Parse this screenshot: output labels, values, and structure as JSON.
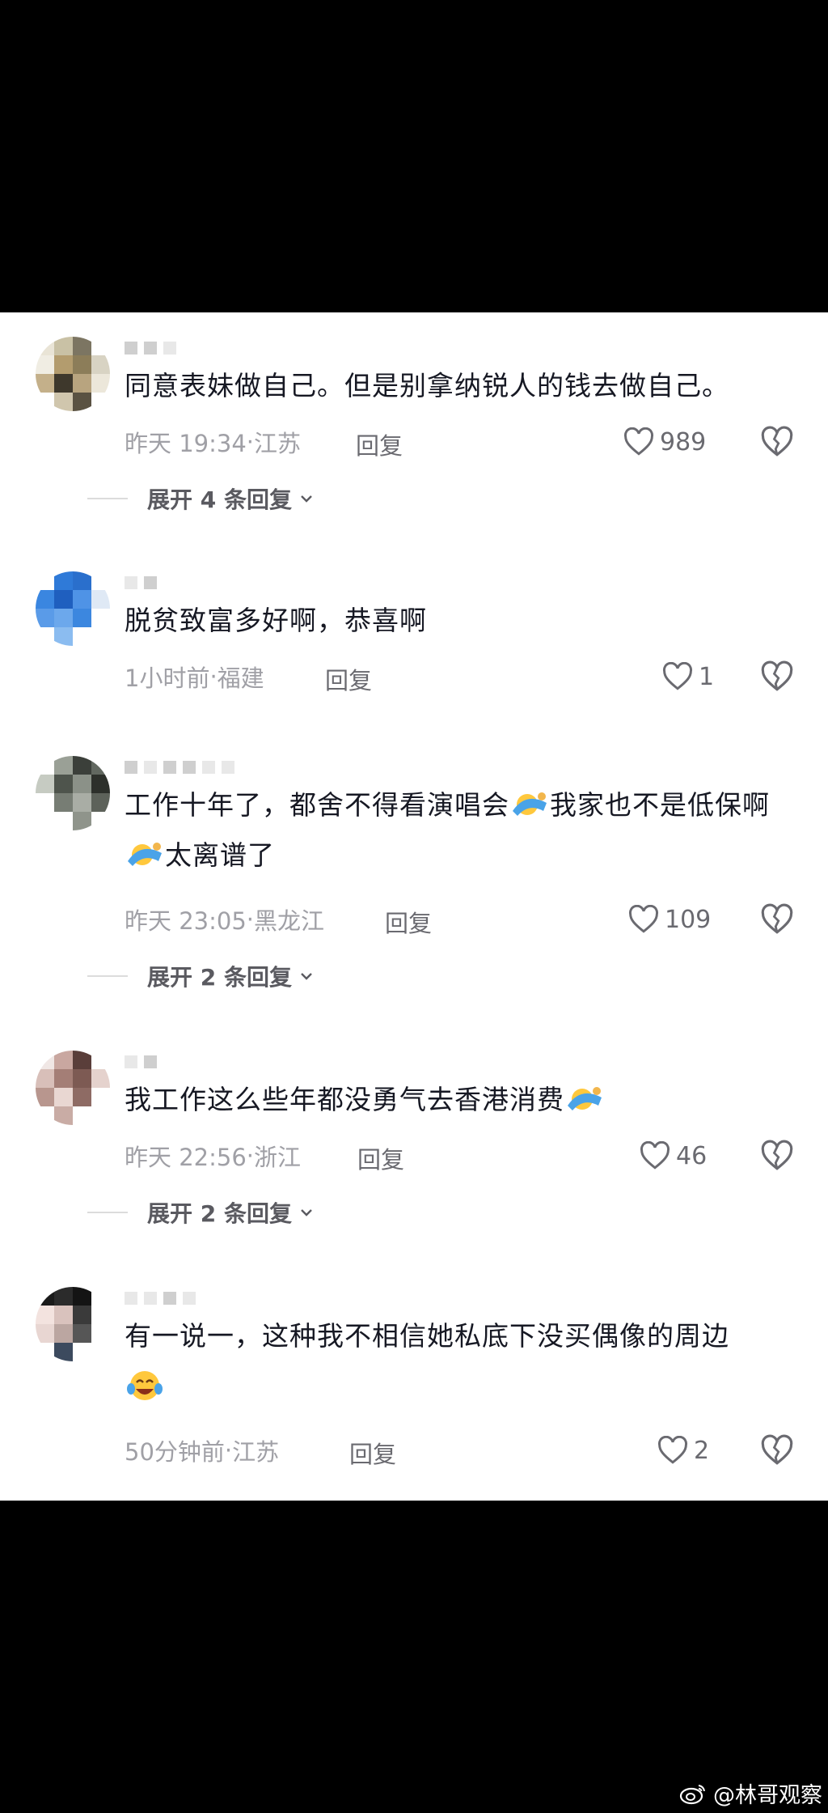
{
  "comments": [
    {
      "text": "同意表妹做自己。但是别拿纳锐人的钱去做自己。",
      "time": "昨天 19:34",
      "location": "江苏",
      "reply_label": "回复",
      "likes": "989",
      "expand_label": "展开 4 条回复"
    },
    {
      "text": "脱贫致富多好啊，恭喜啊",
      "time": "1小时前",
      "location": "福建",
      "reply_label": "回复",
      "likes": "1"
    },
    {
      "text_part1": "工作十年了，都舍不得看演唱会",
      "text_part2": "我家也不是低保啊",
      "text_part3": "太离谱了",
      "time": "昨天 23:05",
      "location": "黑龙江",
      "reply_label": "回复",
      "likes": "109",
      "expand_label": "展开 2 条回复"
    },
    {
      "text": "我工作这么些年都没勇气去香港消费",
      "time": "昨天 22:56",
      "location": "浙江",
      "reply_label": "回复",
      "likes": "46",
      "expand_label": "展开 2 条回复"
    },
    {
      "text": "有一说一，这种我不相信她私底下没买偶像的周边",
      "time": "50分钟前",
      "location": "江苏",
      "reply_label": "回复",
      "likes": "2"
    }
  ],
  "separator": "·",
  "watermark": {
    "text": "@林哥观察",
    "icon": "weibo-icon"
  },
  "icons": {
    "like": "heart-outline-icon",
    "dislike": "broken-heart-icon",
    "expand": "chevron-down-icon"
  },
  "colors": {
    "background": "#000000",
    "panel": "#ffffff",
    "text": "#161823",
    "meta": "#a0a0a6"
  }
}
